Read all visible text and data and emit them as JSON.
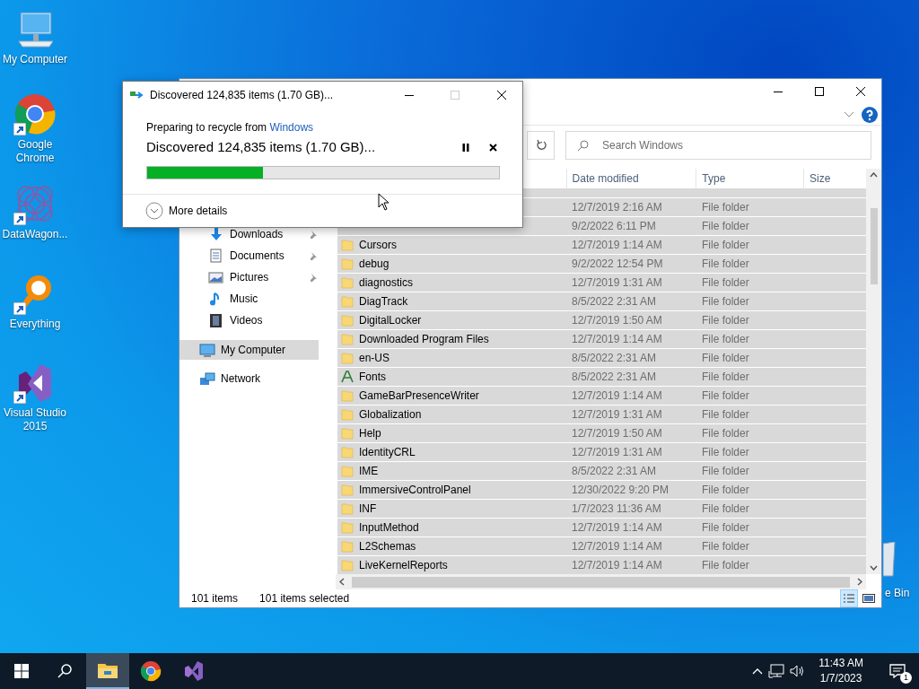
{
  "desktop_icons": [
    {
      "label": "My Computer",
      "shortcut": false
    },
    {
      "label": "Google Chrome",
      "shortcut": true
    },
    {
      "label": "DataWagon...",
      "shortcut": true
    },
    {
      "label": "Everything",
      "shortcut": true
    },
    {
      "label": "Visual Studio 2015",
      "shortcut": true
    }
  ],
  "recycle_bin": {
    "label": "e Bin"
  },
  "explorer": {
    "search": {
      "placeholder": "Search Windows"
    },
    "nav": [
      {
        "label": "Downloads",
        "kind": "quick-access",
        "pinned": true,
        "selected": false
      },
      {
        "label": "Documents",
        "kind": "quick-access",
        "pinned": true,
        "selected": false
      },
      {
        "label": "Pictures",
        "kind": "quick-access",
        "pinned": true,
        "selected": false
      },
      {
        "label": "Music",
        "kind": "quick-access",
        "pinned": false,
        "selected": false
      },
      {
        "label": "Videos",
        "kind": "quick-access",
        "pinned": false,
        "selected": false
      },
      {
        "label": "My Computer",
        "kind": "location",
        "pinned": false,
        "selected": true
      },
      {
        "label": "Network",
        "kind": "location",
        "pinned": false,
        "selected": false
      }
    ],
    "columns": [
      "Date modified",
      "Type",
      "Size"
    ],
    "rows": [
      {
        "date": "12/7/2019 2:16 AM",
        "type": "File folder",
        "selected": true
      },
      {
        "date": "9/2/2022 6:11 PM",
        "type": "File folder",
        "selected": true
      },
      {
        "kind": "folder",
        "name": "Cursors",
        "date": "12/7/2019 1:14 AM",
        "type": "File folder",
        "selected": true
      },
      {
        "kind": "folder",
        "name": "debug",
        "date": "9/2/2022 12:54 PM",
        "type": "File folder",
        "selected": true
      },
      {
        "kind": "folder",
        "name": "diagnostics",
        "date": "12/7/2019 1:31 AM",
        "type": "File folder",
        "selected": true
      },
      {
        "kind": "folder",
        "name": "DiagTrack",
        "date": "8/5/2022 2:31 AM",
        "type": "File folder",
        "selected": true
      },
      {
        "kind": "folder",
        "name": "DigitalLocker",
        "date": "12/7/2019 1:50 AM",
        "type": "File folder",
        "selected": true
      },
      {
        "kind": "folder",
        "name": "Downloaded Program Files",
        "date": "12/7/2019 1:14 AM",
        "type": "File folder",
        "selected": true
      },
      {
        "kind": "folder",
        "name": "en-US",
        "date": "8/5/2022 2:31 AM",
        "type": "File folder",
        "selected": true
      },
      {
        "kind": "font",
        "name": "Fonts",
        "date": "8/5/2022 2:31 AM",
        "type": "File folder",
        "selected": true
      },
      {
        "kind": "folder",
        "name": "GameBarPresenceWriter",
        "date": "12/7/2019 1:14 AM",
        "type": "File folder",
        "selected": true
      },
      {
        "kind": "folder",
        "name": "Globalization",
        "date": "12/7/2019 1:31 AM",
        "type": "File folder",
        "selected": true
      },
      {
        "kind": "folder",
        "name": "Help",
        "date": "12/7/2019 1:50 AM",
        "type": "File folder",
        "selected": true
      },
      {
        "kind": "folder",
        "name": "IdentityCRL",
        "date": "12/7/2019 1:31 AM",
        "type": "File folder",
        "selected": true
      },
      {
        "kind": "folder",
        "name": "IME",
        "date": "8/5/2022 2:31 AM",
        "type": "File folder",
        "selected": true
      },
      {
        "kind": "folder",
        "name": "ImmersiveControlPanel",
        "date": "12/30/2022 9:20 PM",
        "type": "File folder",
        "selected": true
      },
      {
        "kind": "folder",
        "name": "INF",
        "date": "1/7/2023 11:36 AM",
        "type": "File folder",
        "selected": true
      },
      {
        "kind": "folder",
        "name": "InputMethod",
        "date": "12/7/2019 1:14 AM",
        "type": "File folder",
        "selected": true
      },
      {
        "kind": "folder",
        "name": "L2Schemas",
        "date": "12/7/2019 1:14 AM",
        "type": "File folder",
        "selected": true
      },
      {
        "kind": "folder",
        "name": "LiveKernelReports",
        "date": "12/7/2019 1:14 AM",
        "type": "File folder",
        "selected": true
      }
    ],
    "status_bar": {
      "count": "101 items",
      "selection": "101 items selected"
    }
  },
  "dialog": {
    "title": "Discovered 124,835 items (1.70 GB)...",
    "prefix": "Preparing to recycle from ",
    "source": "Windows",
    "status": "Discovered 124,835 items (1.70 GB)...",
    "level": 0.33,
    "details": "More details"
  },
  "taskbar": {
    "apps": [
      {
        "active": true
      },
      {
        "active": false
      },
      {
        "active": false
      }
    ],
    "time": "11:43 AM",
    "date": "1/7/2023",
    "notifications": "1"
  }
}
